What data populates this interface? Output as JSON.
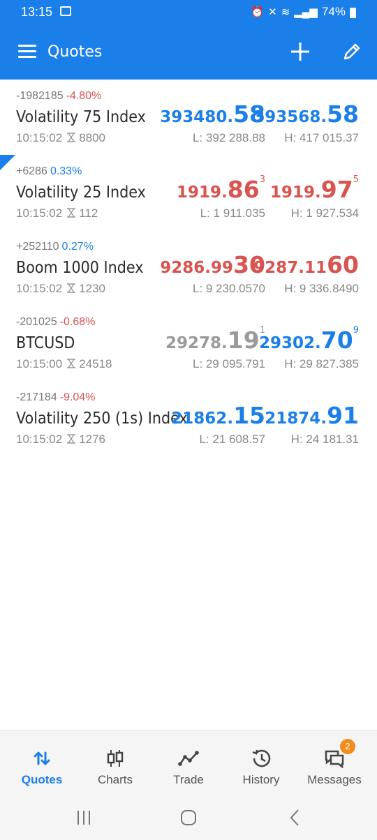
{
  "status": {
    "time": "13:15",
    "battery": "74%"
  },
  "app_bar": {
    "title": "Quotes"
  },
  "quotes": [
    {
      "change": "-1982185",
      "pct": "-4.80%",
      "symbol": "Volatility 75 Index",
      "time": "10:15:02",
      "spread": "8800",
      "bid_main": "393480.",
      "bid_big": "58",
      "bid_sup": "",
      "ask_main": "393568.",
      "ask_big": "58",
      "ask_sup": "",
      "low": "L: 392 288.88",
      "high": "H: 417 015.37"
    },
    {
      "change": "+6286",
      "pct": "0.33%",
      "symbol": "Volatility 25 Index",
      "time": "10:15:02",
      "spread": "112",
      "bid_main": "1919.",
      "bid_big": "86",
      "bid_sup": "3",
      "ask_main": "1919.",
      "ask_big": "97",
      "ask_sup": "5",
      "low": "L: 1 911.035",
      "high": "H: 1 927.534"
    },
    {
      "change": "+252110",
      "pct": "0.27%",
      "symbol": "Boom 1000 Index",
      "time": "10:15:02",
      "spread": "1230",
      "bid_main": "9286.99",
      "bid_big": "30",
      "bid_sup": "",
      "ask_main": "9287.11",
      "ask_big": "60",
      "ask_sup": "",
      "low": "L: 9 230.0570",
      "high": "H: 9 336.8490"
    },
    {
      "change": "-201025",
      "pct": "-0.68%",
      "symbol": "BTCUSD",
      "time": "10:15:00",
      "spread": "24518",
      "bid_main": "29278.",
      "bid_big": "19",
      "bid_sup": "1",
      "ask_main": "29302.",
      "ask_big": "70",
      "ask_sup": "9",
      "low": "L: 29 095.791",
      "high": "H: 29 827.385"
    },
    {
      "change": "-217184",
      "pct": "-9.04%",
      "symbol": "Volatility 250 (1s) Index",
      "time": "10:15:02",
      "spread": "1276",
      "bid_main": "21862.",
      "bid_big": "15",
      "bid_sup": "",
      "ask_main": "21874.",
      "ask_big": "91",
      "ask_sup": "",
      "low": "L: 21 608.57",
      "high": "H: 24 181.31"
    }
  ],
  "bottom_nav": {
    "quotes": "Quotes",
    "charts": "Charts",
    "trade": "Trade",
    "history": "History",
    "messages": "Messages",
    "messages_badge": "2"
  },
  "colors": {
    "accent": "#1a7fe8",
    "down": "#d9534f",
    "neutral": "#9a9a9a",
    "badge": "#f28c1c"
  }
}
